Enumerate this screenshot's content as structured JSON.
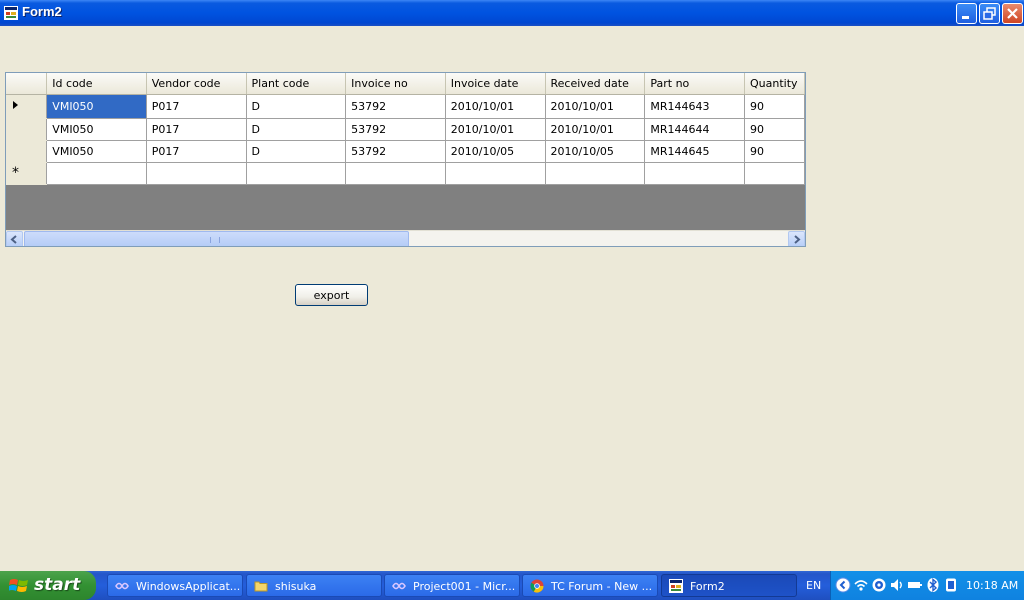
{
  "window": {
    "title": "Form2"
  },
  "grid": {
    "columns": [
      "Id code",
      "Vendor code",
      "Plant code",
      "Invoice no",
      "Invoice date",
      "Received date",
      "Part no",
      "Quantity"
    ],
    "rows": [
      [
        "VMI050",
        "P017",
        "D",
        "53792",
        "2010/10/01",
        "2010/10/01",
        "MR144643",
        "90"
      ],
      [
        "VMI050",
        "P017",
        "D",
        "53792",
        "2010/10/01",
        "2010/10/01",
        "MR144644",
        "90"
      ],
      [
        "VMI050",
        "P017",
        "D",
        "53792",
        "2010/10/05",
        "2010/10/05",
        "MR144645",
        "90"
      ]
    ],
    "new_row_marker": "*"
  },
  "buttons": {
    "export": "export"
  },
  "taskbar": {
    "start": "start",
    "tasks": [
      "WindowsApplicat...",
      "shisuka",
      "Project001 - Micr...",
      "TC Forum - New ...",
      "Form2"
    ],
    "language": "EN",
    "clock": "10:18 AM"
  },
  "colors": {
    "selection": "#316ac5",
    "titlebar": "#0053e0",
    "taskbar": "#245edb"
  }
}
